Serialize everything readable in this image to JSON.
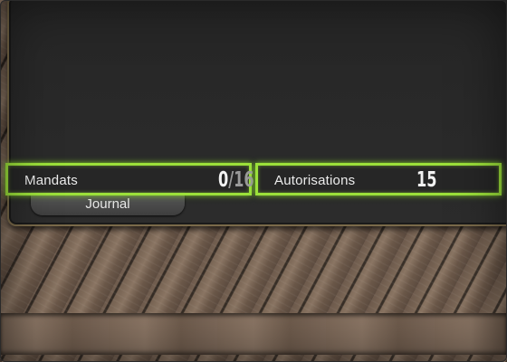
{
  "journal": {
    "tab_label": "Journal"
  },
  "stats": {
    "mandats": {
      "label": "Mandats",
      "current": "0",
      "max": "16"
    },
    "autorisations": {
      "label": "Autorisations",
      "value": "15"
    }
  },
  "colors": {
    "highlight": "#9be03a",
    "panel_bg": "#262626",
    "panel_border": "#7a6a4a"
  }
}
